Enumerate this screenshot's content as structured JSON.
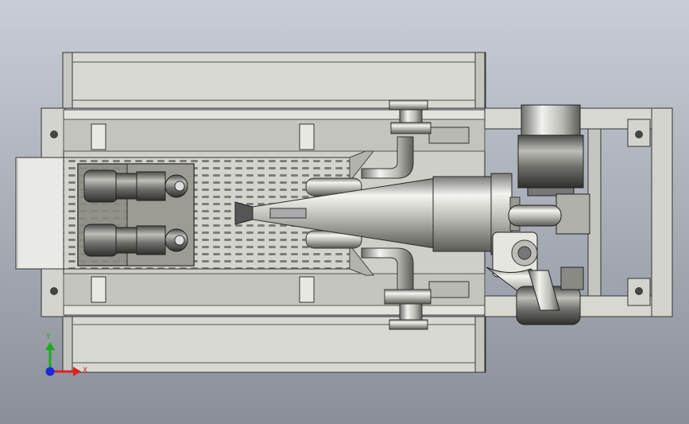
{
  "triad": {
    "x_label": "X",
    "y_label": "Y",
    "x_color": "#e02020",
    "y_color": "#18b018",
    "z_color": "#1a2ad8"
  },
  "colors": {
    "bg_top": "#c8ccd4",
    "bg_bottom": "#8e939d",
    "metal": "#d9d9d4",
    "metal_dark": "#6d6d68",
    "outline": "#2a2a2a"
  },
  "icons": {
    "triad": "coordinate-triad-icon"
  }
}
